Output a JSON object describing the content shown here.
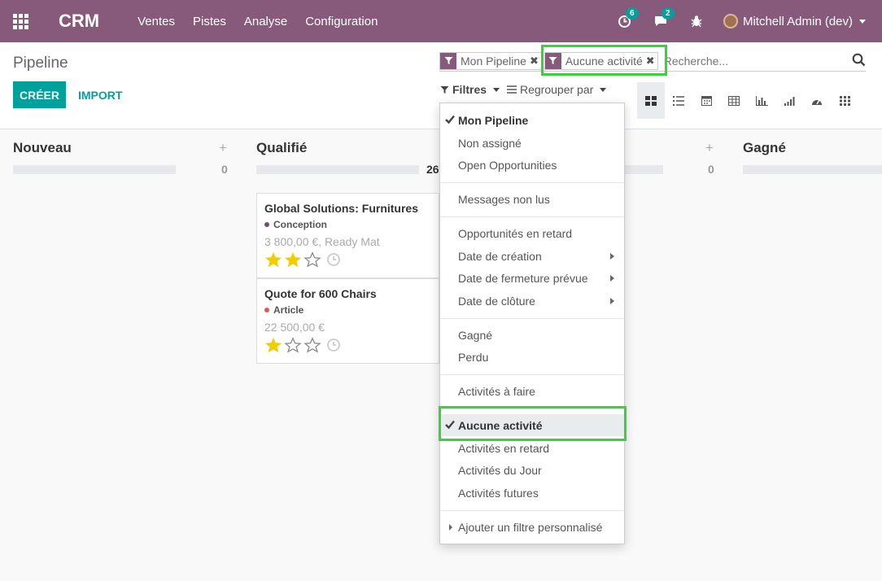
{
  "navbar": {
    "brand": "CRM",
    "menu": [
      "Ventes",
      "Pistes",
      "Analyse",
      "Configuration"
    ],
    "activity_count": "6",
    "messages_count": "2",
    "user": "Mitchell Admin (dev)"
  },
  "control": {
    "title": "Pipeline",
    "create_label": "CRÉER",
    "import_label": "IMPORT",
    "facets": [
      "Mon Pipeline",
      "Aucune activité"
    ],
    "search_placeholder": "Recherche...",
    "filters_label": "Filtres",
    "groupby_label": "Regrouper par",
    "views": [
      "kanban-icon",
      "list-icon",
      "calendar-icon",
      "pivot-icon",
      "graph-icon",
      "cohort-icon",
      "dashboard-icon",
      "grid-icon"
    ]
  },
  "kanban": {
    "columns": [
      {
        "title": "Nouveau",
        "count": "0",
        "plus": "+"
      },
      {
        "title": "Qualifié",
        "count": "26"
      },
      {
        "title": "",
        "count": "0",
        "plus": "+"
      },
      {
        "title": "Gagné"
      }
    ],
    "cards": [
      {
        "title": "Global Solutions: Furnitures",
        "tag": "Conception",
        "tag_color": "#7c4a6f",
        "sub": "3 800,00 €, Ready Mat",
        "stars": 2
      },
      {
        "title": "Quote for 600 Chairs",
        "tag": "Article",
        "tag_color": "#e8554e",
        "sub": "22 500,00 €",
        "stars": 1
      }
    ]
  },
  "filters": {
    "items": [
      "Mon Pipeline",
      "Non assigné",
      "Open Opportunities",
      "Messages non lus",
      "Opportunités en retard",
      "Date de création",
      "Date de fermeture prévue",
      "Date de clôture",
      "Gagné",
      "Perdu",
      "Activités à faire",
      "Aucune activité",
      "Activités en retard",
      "Activités du Jour",
      "Activités futures",
      "Ajouter un filtre personnalisé"
    ]
  },
  "colors": {
    "brand": "#875a7b",
    "accent": "#00a09d",
    "highlight": "#3bd13b"
  }
}
